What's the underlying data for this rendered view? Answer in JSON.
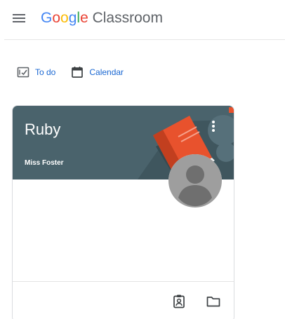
{
  "header": {
    "brand_letters": [
      {
        "char": "G",
        "color": "#4285f4"
      },
      {
        "char": "o",
        "color": "#ea4335"
      },
      {
        "char": "o",
        "color": "#fbbc05"
      },
      {
        "char": "g",
        "color": "#4285f4"
      },
      {
        "char": "l",
        "color": "#34a853"
      },
      {
        "char": "e",
        "color": "#ea4335"
      }
    ],
    "brand_suffix": " Classroom",
    "menu_icon": "hamburger-menu-icon"
  },
  "nav": {
    "todo_label": "To do",
    "todo_icon": "todo-checklist-icon",
    "calendar_label": "Calendar",
    "calendar_icon": "calendar-icon"
  },
  "class_card": {
    "title": "Ruby",
    "teacher": "Miss Foster",
    "banner_color": "#4a636c",
    "more_icon": "more-vert-icon",
    "avatar_icon": "default-avatar-icon",
    "footer_icons": [
      "assignment-ind-icon",
      "folder-icon"
    ]
  },
  "colors": {
    "accent": "#1967d2",
    "text_muted": "#5f6368",
    "book_orange": "#e8522d"
  }
}
